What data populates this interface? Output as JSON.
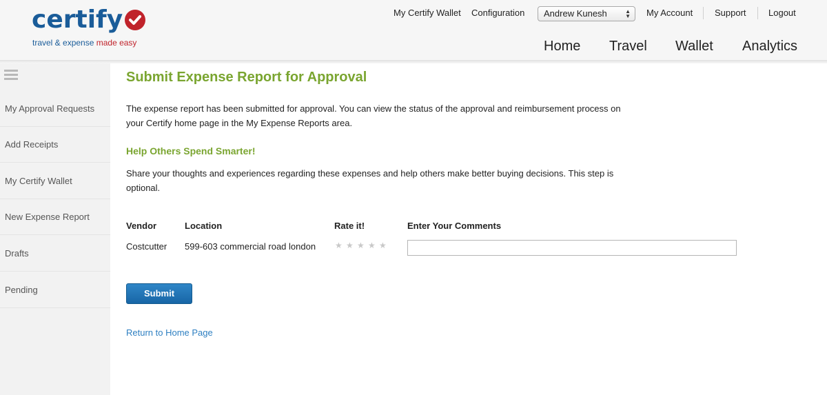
{
  "brand": {
    "name": "certify",
    "tagline_main": "travel & expense ",
    "tagline_accent": "made easy",
    "brand_color": "#1a5c99",
    "accent_color": "#c0232b"
  },
  "top_nav": {
    "wallet": "My Certify Wallet",
    "configuration": "Configuration",
    "user_select": "Andrew Kunesh",
    "account": "My Account",
    "support": "Support",
    "logout": "Logout"
  },
  "main_nav": [
    "Home",
    "Travel",
    "Wallet",
    "Analytics"
  ],
  "sidebar": {
    "items": [
      {
        "label": "My Approval Requests"
      },
      {
        "label": "Add Receipts"
      },
      {
        "label": "My Certify Wallet"
      },
      {
        "label": "New Expense Report"
      },
      {
        "label": "Drafts"
      },
      {
        "label": "Pending"
      }
    ]
  },
  "page": {
    "title": "Submit Expense Report for Approval",
    "intro": "The expense report has been submitted for approval. You can view the status of the approval and reimbursement process on your Certify home page in the My Expense Reports area.",
    "subheading": "Help Others Spend Smarter!",
    "share_text": "Share your thoughts and experiences regarding these expenses and help others make better buying decisions. This step is optional."
  },
  "table": {
    "headers": {
      "vendor": "Vendor",
      "location": "Location",
      "rating": "Rate it!",
      "comments": "Enter Your Comments"
    },
    "rows": [
      {
        "vendor": "Costcutter",
        "location": "599-603 commercial road london",
        "rating": 0,
        "rating_max": 5,
        "comment": ""
      }
    ]
  },
  "actions": {
    "submit": "Submit",
    "return_home": "Return to Home Page"
  },
  "colors": {
    "heading_green": "#7aa530",
    "link_blue": "#2d7fc1",
    "button_blue": "#1866a6"
  }
}
